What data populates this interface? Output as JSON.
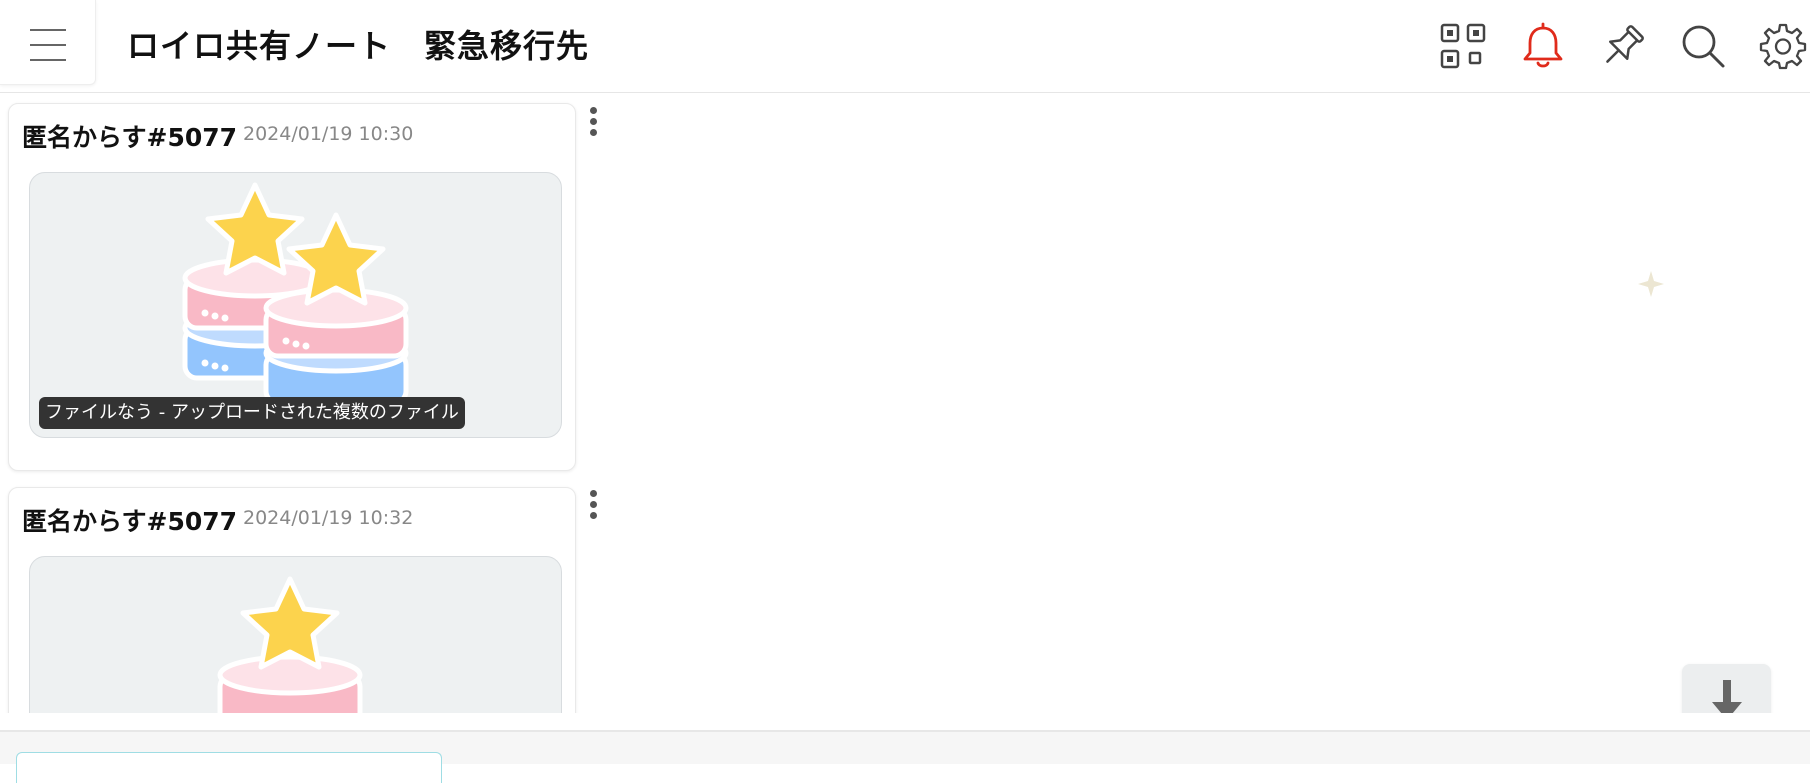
{
  "header": {
    "title": "ロイロ共有ノート　緊急移行先",
    "icons": [
      "menu-icon",
      "qr-code-icon",
      "bell-icon",
      "pin-icon",
      "search-icon",
      "gear-icon"
    ],
    "bell_color": "#e02b1b"
  },
  "posts": [
    {
      "user": "匿名からす#5077",
      "time": "2024/01/19 10:30",
      "caption": "ファイルなう - アップロードされた複数のファイル",
      "image": "multiple-files-illustration"
    },
    {
      "user": "匿名からす#5077",
      "time": "2024/01/19 10:32",
      "image": "single-file-illustration"
    }
  ],
  "colors": {
    "star": "#fcd34d",
    "pink": "#f9b9c6",
    "blue": "#93c5fd"
  }
}
